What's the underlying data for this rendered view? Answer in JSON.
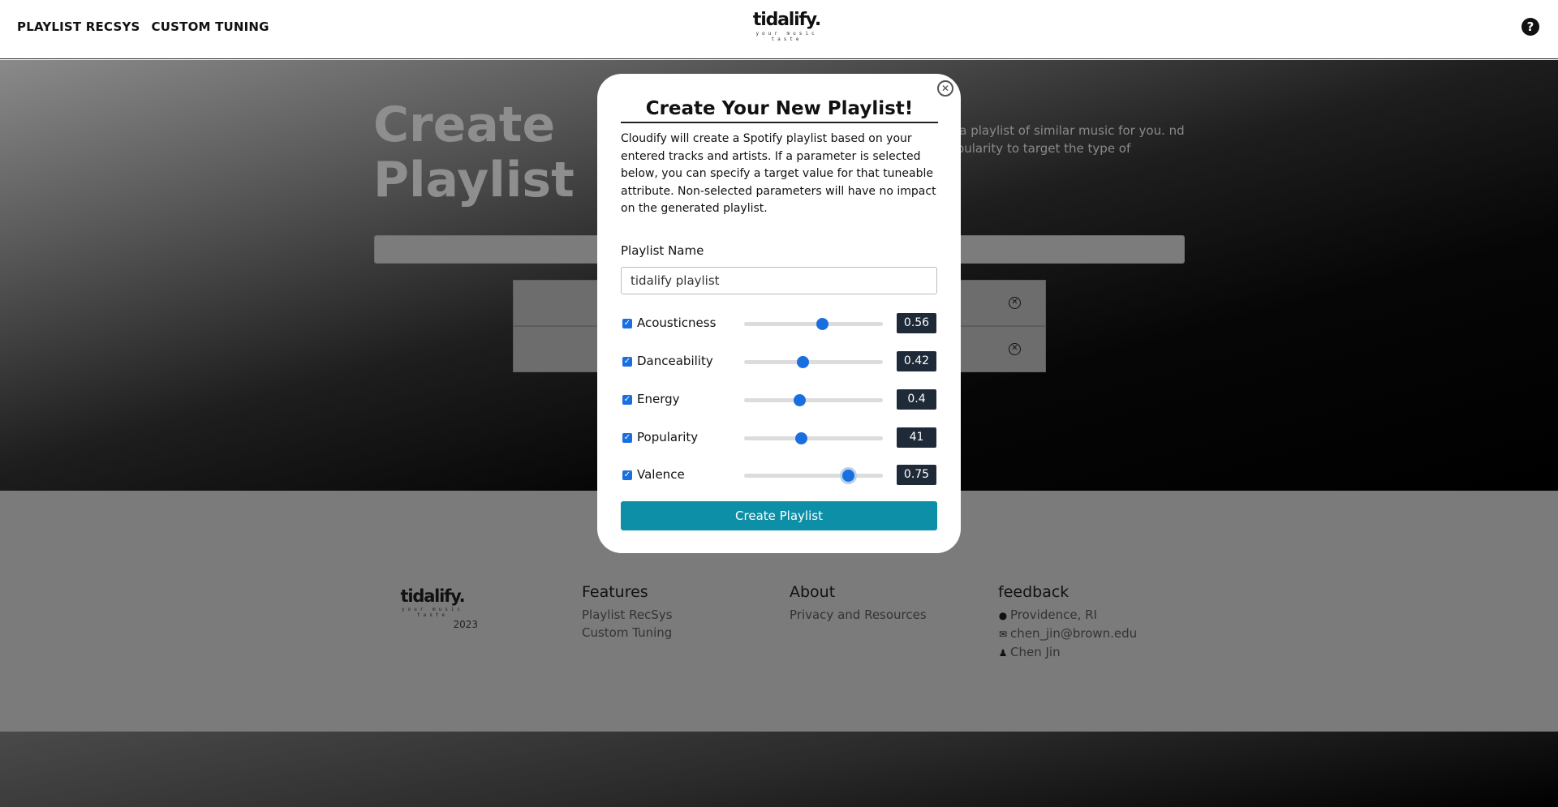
{
  "nav": {
    "links": [
      "PLAYLIST RECSYS",
      "CUSTOM TUNING"
    ],
    "brand_name": "tidalify.",
    "brand_tagline": "your music taste",
    "help_icon": "question-circle-icon"
  },
  "hero": {
    "title": "Create Playlist",
    "description": "ce a playlist of similar music for you. nd popularity to target the type of"
  },
  "modal": {
    "title": "Create Your New Playlist!",
    "description": "Cloudify will create a Spotify playlist based on your entered tracks and artists. If a parameter is selected below, you can specify a target value for that tuneable attribute. Non-selected parameters will have no impact on the generated playlist.",
    "name_label": "Playlist Name",
    "name_value": "tidalify playlist",
    "params": [
      {
        "label": "Acousticness",
        "checked": true,
        "value": "0.56",
        "fraction": 0.56
      },
      {
        "label": "Danceability",
        "checked": true,
        "value": "0.42",
        "fraction": 0.42
      },
      {
        "label": "Energy",
        "checked": true,
        "value": "0.4",
        "fraction": 0.4
      },
      {
        "label": "Popularity",
        "checked": true,
        "value": "41",
        "fraction": 0.41
      },
      {
        "label": "Valence",
        "checked": true,
        "value": "0.75",
        "fraction": 0.75
      }
    ],
    "submit_label": "Create Playlist"
  },
  "footer": {
    "brand_name": "tidalify.",
    "brand_tagline": "your music taste",
    "year": "2023",
    "features": {
      "heading": "Features",
      "links": [
        "Playlist RecSys",
        "Custom Tuning"
      ]
    },
    "about": {
      "heading": "About",
      "links": [
        "Privacy and Resources"
      ]
    },
    "feedback": {
      "heading": "feedback",
      "items": [
        {
          "icon": "map-pin-icon",
          "text": "Providence, RI"
        },
        {
          "icon": "envelope-icon",
          "text": "chen_jin@brown.edu"
        },
        {
          "icon": "user-icon",
          "text": "Chen Jin"
        }
      ]
    }
  }
}
